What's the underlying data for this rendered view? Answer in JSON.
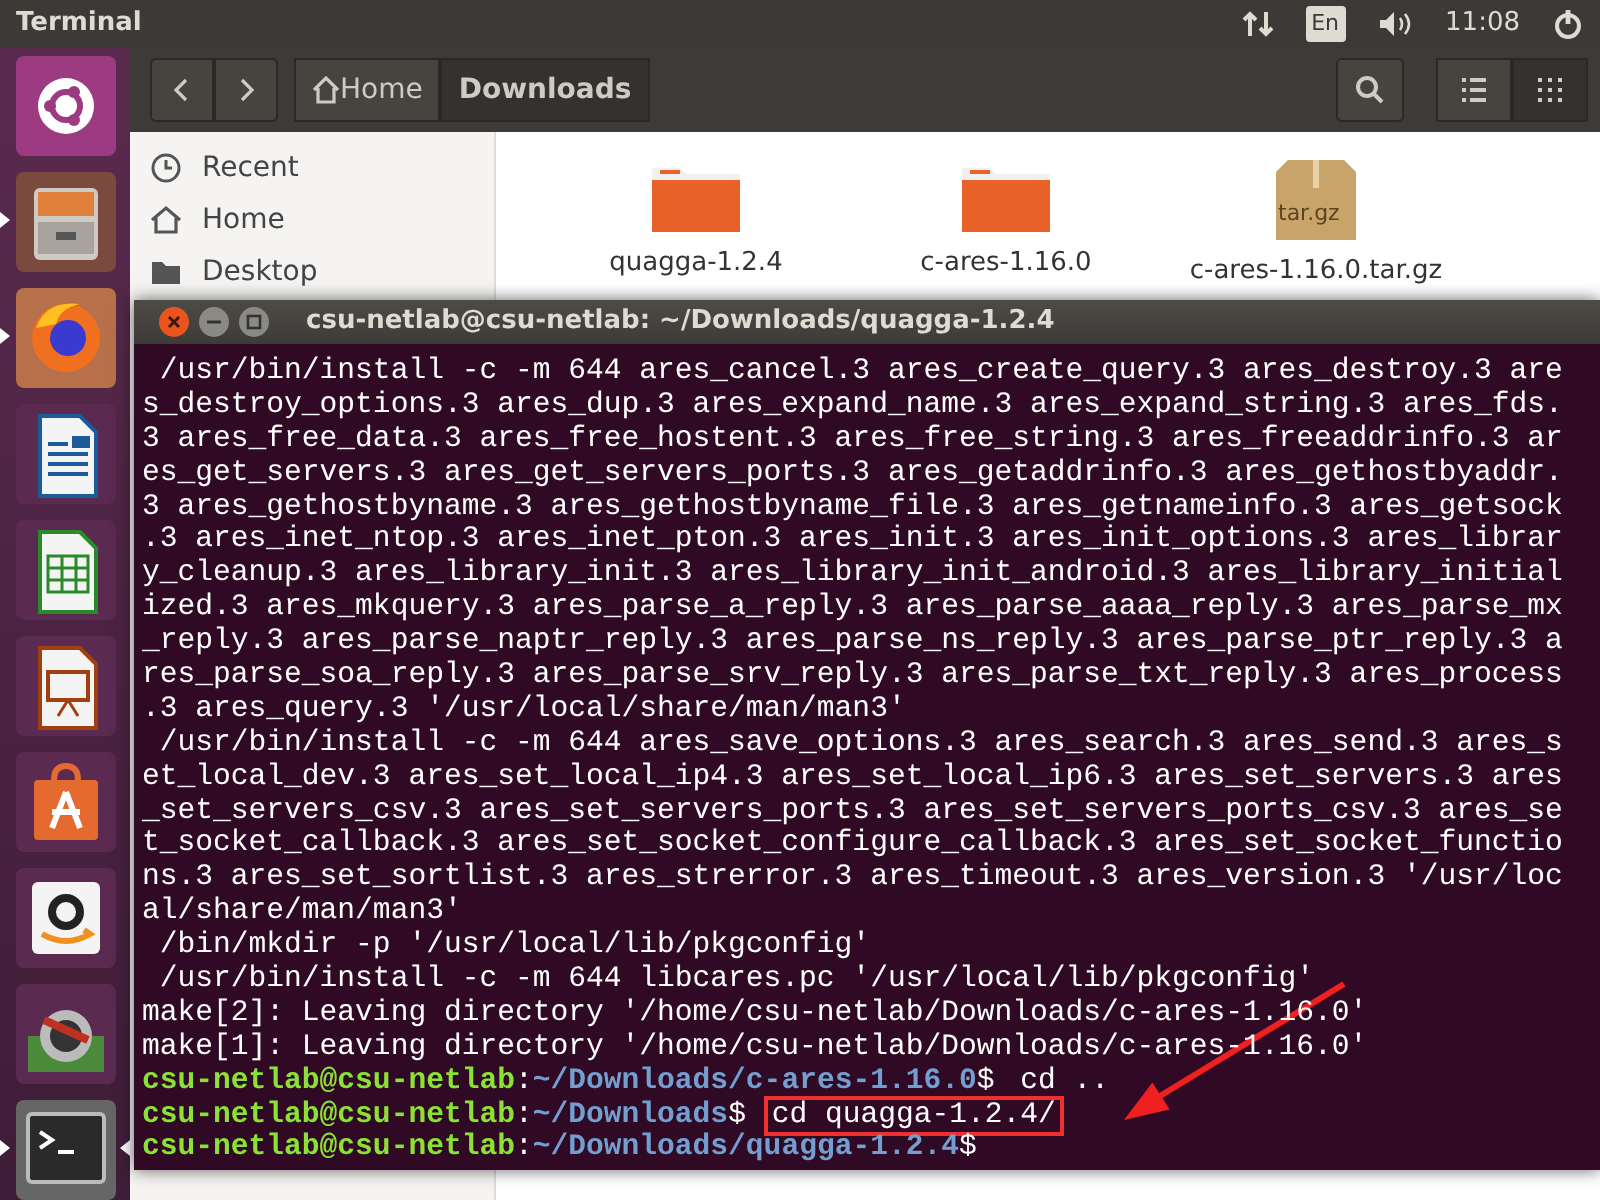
{
  "top_bar": {
    "title": "Terminal",
    "keyboard_layout": "En",
    "time": "11:08"
  },
  "launcher": [
    {
      "kind": "ubuntu",
      "running": false,
      "active": false
    },
    {
      "kind": "files",
      "running": true,
      "active": false
    },
    {
      "kind": "browser",
      "running": true,
      "active": false
    },
    {
      "kind": "writer",
      "running": false,
      "active": false
    },
    {
      "kind": "calc",
      "running": false,
      "active": false
    },
    {
      "kind": "impress",
      "running": false,
      "active": false
    },
    {
      "kind": "store",
      "running": false,
      "active": false
    },
    {
      "kind": "shop",
      "running": false,
      "active": false
    },
    {
      "kind": "updater",
      "running": false,
      "active": false
    },
    {
      "kind": "terminal",
      "running": true,
      "active": true
    }
  ],
  "file_manager": {
    "breadcrumbs": [
      {
        "label": "Home",
        "kind": "home",
        "selected": false
      },
      {
        "label": "Downloads",
        "kind": "folder",
        "selected": true
      }
    ],
    "view_buttons": [
      {
        "kind": "list",
        "selected": false
      },
      {
        "kind": "grid",
        "selected": true
      }
    ],
    "sidebar": [
      {
        "label": "Recent",
        "kind": "recent"
      },
      {
        "label": "Home",
        "kind": "home"
      },
      {
        "label": "Desktop",
        "kind": "folder"
      }
    ],
    "files": [
      {
        "name": "quagga-1.2.4",
        "kind": "folder"
      },
      {
        "name": "c-ares-1.16.0",
        "kind": "folder"
      },
      {
        "name": "c-ares-1.16.0.tar.gz",
        "kind": "archive",
        "badge": "tar.gz"
      }
    ]
  },
  "terminal": {
    "title": "csu-netlab@csu-netlab: ~/Downloads/quagga-1.2.4",
    "lines": [
      {
        "kind": "output",
        "text": " /usr/bin/install -c -m 644 ares_cancel.3 ares_create_query.3 ares_destroy.3 are"
      },
      {
        "kind": "output",
        "text": "s_destroy_options.3 ares_dup.3 ares_expand_name.3 ares_expand_string.3 ares_fds."
      },
      {
        "kind": "output",
        "text": "3 ares_free_data.3 ares_free_hostent.3 ares_free_string.3 ares_freeaddrinfo.3 ar"
      },
      {
        "kind": "output",
        "text": "es_get_servers.3 ares_get_servers_ports.3 ares_getaddrinfo.3 ares_gethostbyaddr."
      },
      {
        "kind": "output",
        "text": "3 ares_gethostbyname.3 ares_gethostbyname_file.3 ares_getnameinfo.3 ares_getsock"
      },
      {
        "kind": "output",
        "text": ".3 ares_inet_ntop.3 ares_inet_pton.3 ares_init.3 ares_init_options.3 ares_librar"
      },
      {
        "kind": "output",
        "text": "y_cleanup.3 ares_library_init.3 ares_library_init_android.3 ares_library_initial"
      },
      {
        "kind": "output",
        "text": "ized.3 ares_mkquery.3 ares_parse_a_reply.3 ares_parse_aaaa_reply.3 ares_parse_mx"
      },
      {
        "kind": "output",
        "text": "_reply.3 ares_parse_naptr_reply.3 ares_parse_ns_reply.3 ares_parse_ptr_reply.3 a"
      },
      {
        "kind": "output",
        "text": "res_parse_soa_reply.3 ares_parse_srv_reply.3 ares_parse_txt_reply.3 ares_process"
      },
      {
        "kind": "output",
        "text": ".3 ares_query.3 '/usr/local/share/man/man3'"
      },
      {
        "kind": "output",
        "text": " /usr/bin/install -c -m 644 ares_save_options.3 ares_search.3 ares_send.3 ares_s"
      },
      {
        "kind": "output",
        "text": "et_local_dev.3 ares_set_local_ip4.3 ares_set_local_ip6.3 ares_set_servers.3 ares"
      },
      {
        "kind": "output",
        "text": "_set_servers_csv.3 ares_set_servers_ports.3 ares_set_servers_ports_csv.3 ares_se"
      },
      {
        "kind": "output",
        "text": "t_socket_callback.3 ares_set_socket_configure_callback.3 ares_set_socket_functio"
      },
      {
        "kind": "output",
        "text": "ns.3 ares_set_sortlist.3 ares_strerror.3 ares_timeout.3 ares_version.3 '/usr/loc"
      },
      {
        "kind": "output",
        "text": "al/share/man/man3'"
      },
      {
        "kind": "output",
        "text": " /bin/mkdir -p '/usr/local/lib/pkgconfig'"
      },
      {
        "kind": "output",
        "text": " /usr/bin/install -c -m 644 libcares.pc '/usr/local/lib/pkgconfig'"
      },
      {
        "kind": "output",
        "text": "make[2]: Leaving directory '/home/csu-netlab/Downloads/c-ares-1.16.0'"
      },
      {
        "kind": "output",
        "text": "make[1]: Leaving directory '/home/csu-netlab/Downloads/c-ares-1.16.0'"
      },
      {
        "kind": "prompt",
        "user": "csu-netlab@csu-netlab",
        "separator": ":",
        "path": "~/Downloads/c-ares-1.16.0",
        "symbol": "$",
        "command": "cd ..",
        "highlighted": false
      },
      {
        "kind": "prompt",
        "user": "csu-netlab@csu-netlab",
        "separator": ":",
        "path": "~/Downloads",
        "symbol": "$",
        "command": "cd quagga-1.2.4/",
        "highlighted": true
      },
      {
        "kind": "prompt",
        "user": "csu-netlab@csu-netlab",
        "separator": ":",
        "path": "~/Downloads/quagga-1.2.4",
        "symbol": "$"
      }
    ]
  }
}
